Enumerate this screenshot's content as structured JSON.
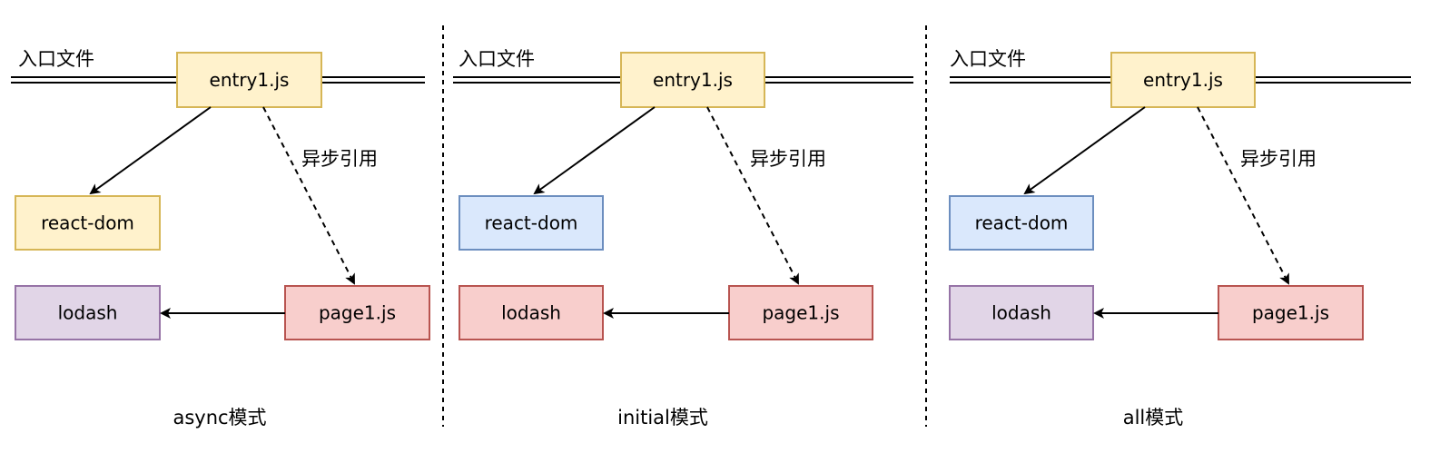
{
  "colors": {
    "yellow_fill": "#fff2cc",
    "yellow_stroke": "#d6b656",
    "blue_fill": "#dae8fc",
    "blue_stroke": "#6c8ebf",
    "purple_fill": "#e1d5e7",
    "purple_stroke": "#9673a6",
    "red_fill": "#f8cecc",
    "red_stroke": "#b85450"
  },
  "panels": [
    {
      "entry_label": "入口文件",
      "async_label": "异步引用",
      "mode_label": "async模式",
      "nodes": {
        "entry": {
          "text": "entry1.js",
          "color": "yellow"
        },
        "react": {
          "text": "react-dom",
          "color": "yellow"
        },
        "lodash": {
          "text": "lodash",
          "color": "purple"
        },
        "page": {
          "text": "page1.js",
          "color": "red"
        }
      }
    },
    {
      "entry_label": "入口文件",
      "async_label": "异步引用",
      "mode_label": "initial模式",
      "nodes": {
        "entry": {
          "text": "entry1.js",
          "color": "yellow"
        },
        "react": {
          "text": "react-dom",
          "color": "blue"
        },
        "lodash": {
          "text": "lodash",
          "color": "red"
        },
        "page": {
          "text": "page1.js",
          "color": "red"
        }
      }
    },
    {
      "entry_label": "入口文件",
      "async_label": "异步引用",
      "mode_label": "all模式",
      "nodes": {
        "entry": {
          "text": "entry1.js",
          "color": "yellow"
        },
        "react": {
          "text": "react-dom",
          "color": "blue"
        },
        "lodash": {
          "text": "lodash",
          "color": "purple"
        },
        "page": {
          "text": "page1.js",
          "color": "red"
        }
      }
    }
  ]
}
